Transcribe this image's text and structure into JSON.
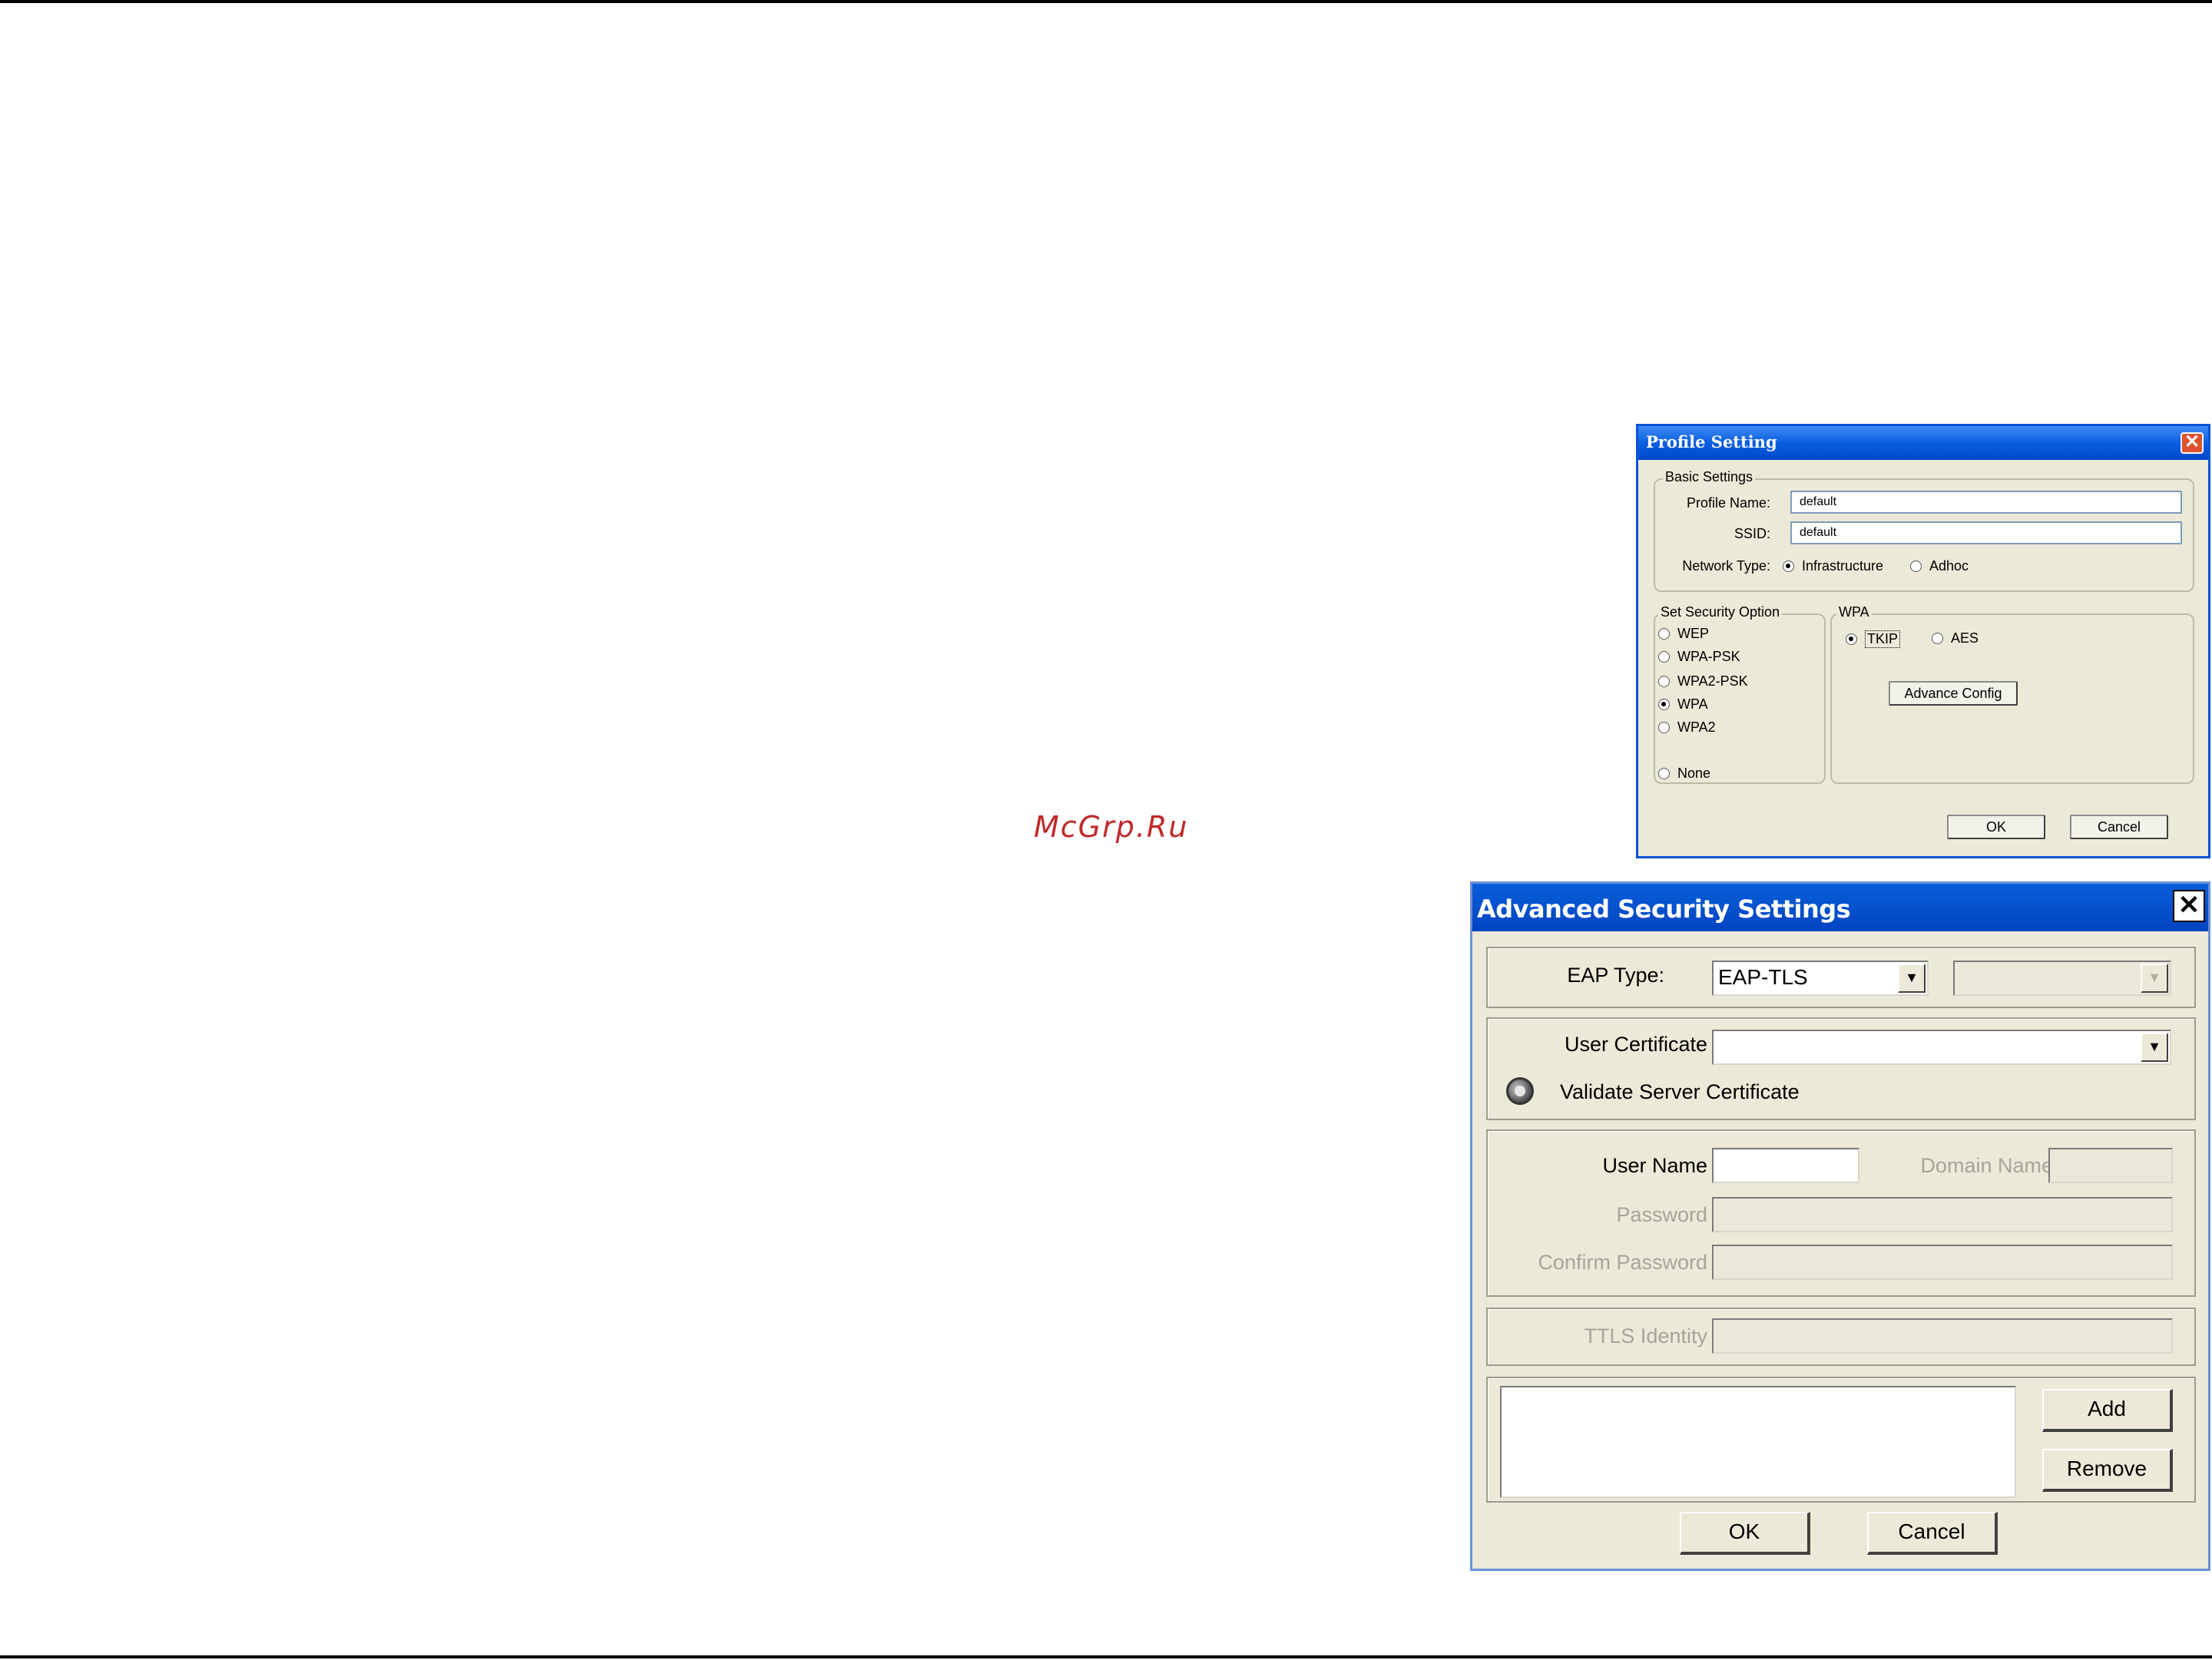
{
  "watermark": "McGrp.Ru",
  "profile_dialog": {
    "title": "Profile Setting",
    "close_glyph": "✕",
    "basic_settings": {
      "legend": "Basic Settings",
      "profile_name_label": "Profile Name:",
      "profile_name_value": "default",
      "ssid_label": "SSID:",
      "ssid_value": "default",
      "network_type_label": "Network Type:",
      "network_types": [
        {
          "label": "Infrastructure",
          "selected": true
        },
        {
          "label": "Adhoc",
          "selected": false
        }
      ]
    },
    "security_option": {
      "legend": "Set Security Option",
      "options": [
        {
          "label": "WEP",
          "selected": false
        },
        {
          "label": "WPA-PSK",
          "selected": false
        },
        {
          "label": "WPA2-PSK",
          "selected": false
        },
        {
          "label": "WPA",
          "selected": true
        },
        {
          "label": "WPA2",
          "selected": false
        },
        {
          "label": "None",
          "selected": false
        }
      ]
    },
    "wpa": {
      "legend": "WPA",
      "ciphers": [
        {
          "label": "TKIP",
          "selected": true
        },
        {
          "label": "AES",
          "selected": false
        }
      ],
      "advance_config_label": "Advance Config"
    },
    "ok_label": "OK",
    "cancel_label": "Cancel"
  },
  "advanced_dialog": {
    "title": "Advanced Security Settings",
    "close_glyph": "✕",
    "eap_type_label": "EAP Type:",
    "eap_type_value": "EAP-TLS",
    "eap_inner_value": "",
    "user_certificate_label": "User Certificate",
    "user_certificate_value": "",
    "validate_server_label": "Validate Server Certificate",
    "user_name_label": "User Name",
    "user_name_value": "",
    "domain_name_label": "Domain Name",
    "password_label": "Password",
    "confirm_password_label": "Confirm Password",
    "ttls_identity_label": "TTLS Identity",
    "add_label": "Add",
    "remove_label": "Remove",
    "ok_label": "OK",
    "cancel_label": "Cancel"
  }
}
